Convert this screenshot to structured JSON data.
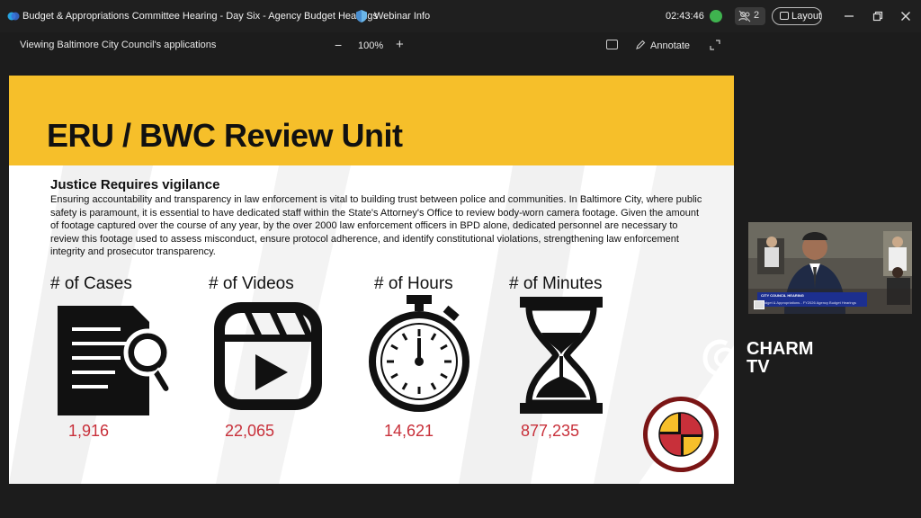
{
  "titlebar": {
    "title": "Budget & Appropriations Committee Hearing - Day Six - Agency Budget Hearings",
    "webinar_info": "Webinar Info",
    "clock": "02:43:46",
    "participants_count": "2",
    "layout_label": "Layout",
    "icons": [
      "webex-logo-icon",
      "shield-icon",
      "status-dot-icon",
      "participants-icon",
      "layout-icon",
      "minimize-icon",
      "restore-icon",
      "close-icon"
    ]
  },
  "share_bar": {
    "viewing_label": "Viewing Baltimore City Council's applications",
    "zoom_minus": "−",
    "zoom_level": "100%",
    "zoom_plus": "+",
    "annotate_label": "Annotate"
  },
  "slide": {
    "title": "ERU / BWC Review Unit",
    "subheading": "Justice Requires vigilance",
    "body": "Ensuring accountability and transparency in law enforcement is vital to building trust between police and communities. In Baltimore City, where public safety is paramount, it is essential to have dedicated staff within the State's Attorney's Office to review body-worn camera footage. Given the amount of footage captured over the course of any year, by the over 2000 law enforcement officers in BPD alone, dedicated personnel are necessary to review this footage used to assess misconduct, ensure protocol adherence, and identify constitutional violations, strengthening law enforcement integrity and prosecutor transparency.",
    "stats": [
      {
        "label": "# of Cases",
        "value": "1,916",
        "icon": "document-search-icon"
      },
      {
        "label": "# of Videos",
        "value": "22,065",
        "icon": "video-play-icon"
      },
      {
        "label": "# of Hours",
        "value": "14,621",
        "icon": "stopwatch-icon"
      },
      {
        "label": "# of Minutes",
        "value": "877,235",
        "icon": "hourglass-icon"
      }
    ],
    "accent_color": "#f6bf2a",
    "value_color": "#c8303a"
  },
  "watermark": {
    "line1": "CHARM",
    "line2": "TV"
  },
  "camera_feed": {
    "banner_line1": "CITY COUNCIL HEARING",
    "banner_line2": "Budget & Appropriations - FY2026 Agency Budget Hearings"
  }
}
